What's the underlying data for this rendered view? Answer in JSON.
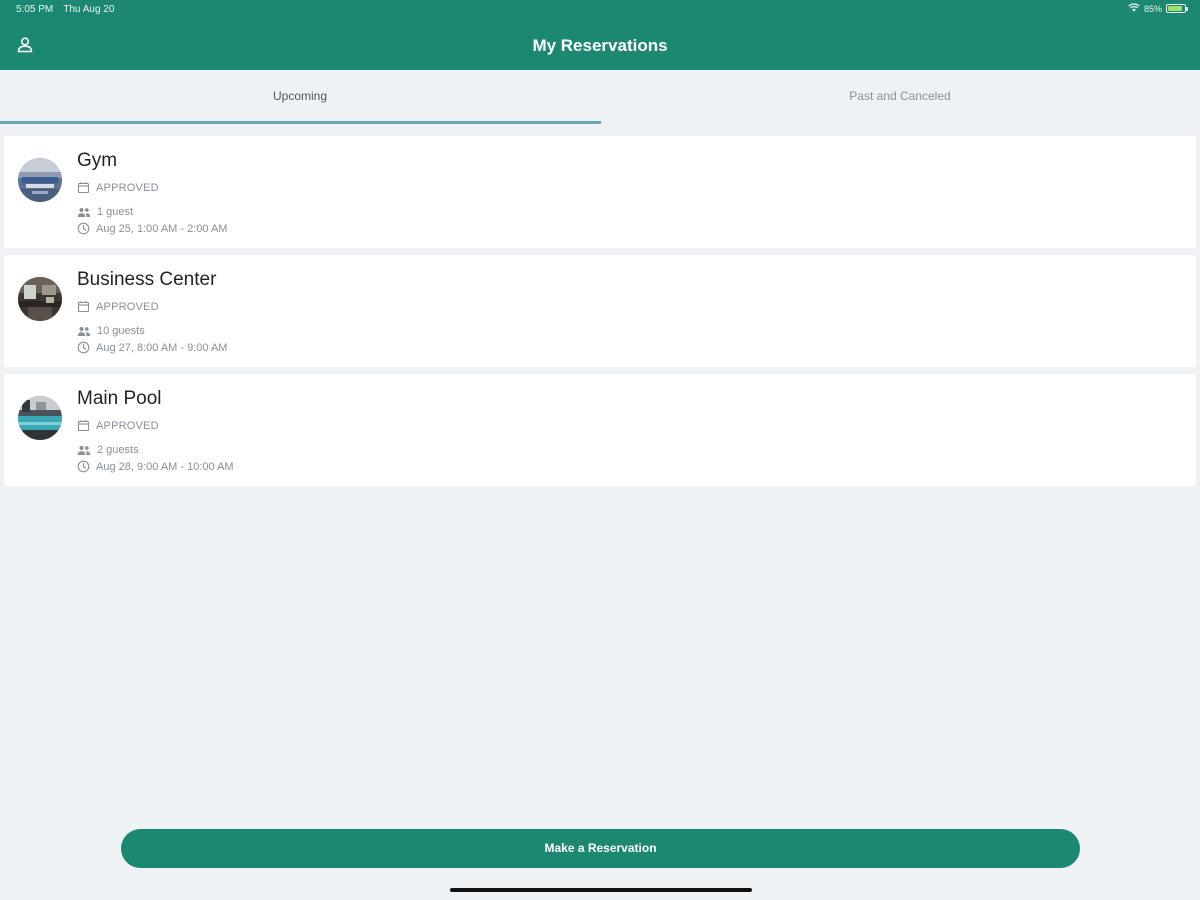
{
  "status_bar": {
    "time": "5:05 PM",
    "date": "Thu Aug 20",
    "battery_text": "85%",
    "battery_level": 0.85
  },
  "header": {
    "title": "My Reservations",
    "profile_icon": "person-icon"
  },
  "tabs": [
    {
      "label": "Upcoming",
      "selected": true
    },
    {
      "label": "Past and Canceled",
      "selected": false
    }
  ],
  "reservations": [
    {
      "title": "Gym",
      "status": "APPROVED",
      "guests": "1 guest",
      "time": "Aug 25, 1:00 AM - 2:00 AM"
    },
    {
      "title": "Business Center",
      "status": "APPROVED",
      "guests": "10 guests",
      "time": "Aug 27, 8:00 AM - 9:00 AM"
    },
    {
      "title": "Main Pool",
      "status": "APPROVED",
      "guests": "2 guests",
      "time": "Aug 28, 9:00 AM - 10:00 AM"
    }
  ],
  "actions": {
    "make_reservation": "Make a Reservation"
  },
  "colors": {
    "brand": "#1c8872",
    "tab_indicator": "#6ba4b6",
    "background": "#eef2f5"
  }
}
